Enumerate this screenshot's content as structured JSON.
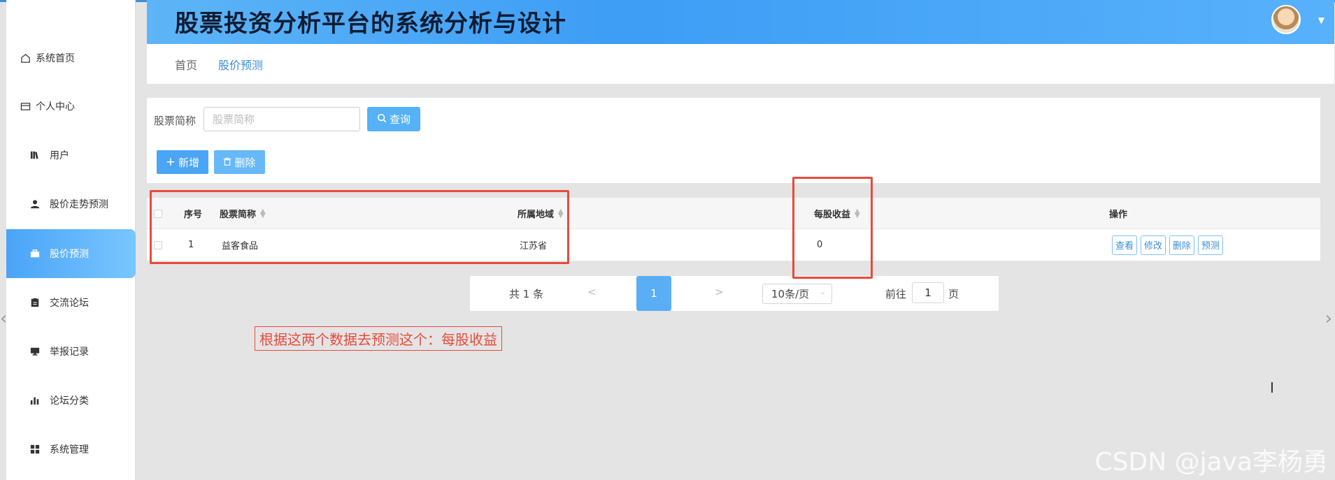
{
  "header": {
    "title": "股票投资分析平台的系统分析与设计",
    "avatar_icon": "user-avatar",
    "caret_icon": "caret-down-icon"
  },
  "sidebar": {
    "items": [
      {
        "label": "系统首页",
        "icon": "home-icon"
      },
      {
        "label": "个人中心",
        "icon": "card-icon"
      },
      {
        "label": "用户",
        "icon": "books-icon"
      },
      {
        "label": "股价走势预测",
        "icon": "person-icon"
      },
      {
        "label": "股价预测",
        "icon": "briefcase-icon",
        "active": true
      },
      {
        "label": "交流论坛",
        "icon": "clipboard-icon"
      },
      {
        "label": "举报记录",
        "icon": "monitor-icon"
      },
      {
        "label": "论坛分类",
        "icon": "bar-chart-icon"
      },
      {
        "label": "系统管理",
        "icon": "grid-icon"
      }
    ]
  },
  "breadcrumb": {
    "home": "首页",
    "current": "股价预测"
  },
  "filter": {
    "label": "股票简称",
    "placeholder": "股票简称",
    "query_button": "查询",
    "add_button": "新增",
    "delete_button": "删除"
  },
  "table": {
    "headers": {
      "index": "序号",
      "name": "股票简称",
      "region": "所属地域",
      "eps": "每股收益",
      "actions": "操作"
    },
    "rows": [
      {
        "index": "1",
        "name": "益客食品",
        "region": "江苏省",
        "eps": "0"
      }
    ],
    "row_actions": [
      "查看",
      "修改",
      "删除",
      "预测"
    ]
  },
  "pager": {
    "total": "共 1 条",
    "prev": "<",
    "current_page": "1",
    "next": ">",
    "page_size": "10条/页",
    "goto_label": "前往",
    "goto_value": "1",
    "goto_suffix": "页"
  },
  "annotation": {
    "note": "根据这两个数据去预测这个：每股收益"
  },
  "watermark": "CSDN @java李杨勇",
  "colors": {
    "accent": "#4aa5f4",
    "annotation": "#e94a3c",
    "header_start": "#5db5f7"
  }
}
